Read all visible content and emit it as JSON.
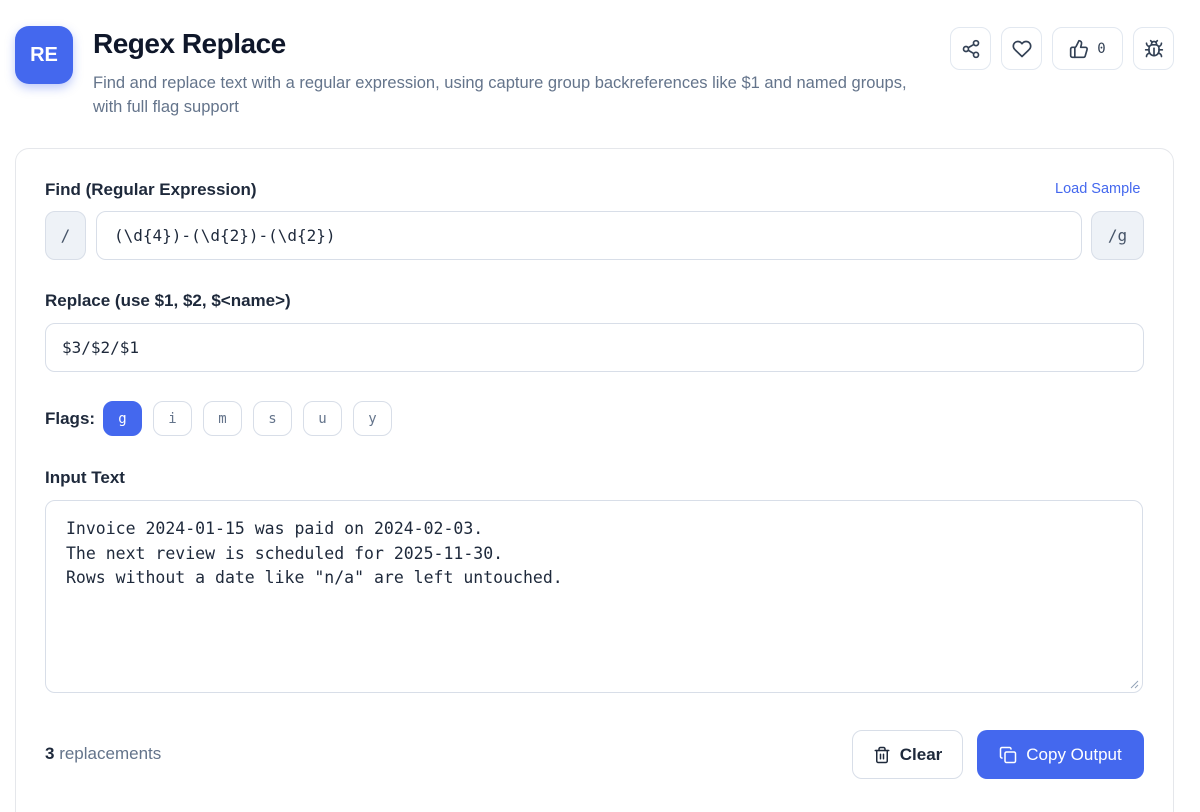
{
  "header": {
    "logo_text": "RE",
    "title": "Regex Replace",
    "subtitle": "Find and replace text with a regular expression, using capture group backreferences like $1 and named groups, with full flag support",
    "like_count": "0",
    "icons": [
      "share-icon",
      "heart-icon",
      "thumbs-up-icon",
      "bug-icon"
    ]
  },
  "find": {
    "label": "Find (Regular Expression)",
    "load_sample": "Load Sample",
    "prefix": "/",
    "value": "(\\d{4})-(\\d{2})-(\\d{2})",
    "suffix": "/g"
  },
  "replace": {
    "label": "Replace (use $1, $2, $<name>)",
    "value": "$3/$2/$1"
  },
  "flags": {
    "label": "Flags:",
    "items": [
      {
        "flag": "g",
        "active": true
      },
      {
        "flag": "i",
        "active": false
      },
      {
        "flag": "m",
        "active": false
      },
      {
        "flag": "s",
        "active": false
      },
      {
        "flag": "u",
        "active": false
      },
      {
        "flag": "y",
        "active": false
      }
    ]
  },
  "input": {
    "label": "Input Text",
    "value": "Invoice 2024-01-15 was paid on 2024-02-03.\nThe next review is scheduled for 2025-11-30.\nRows without a date like \"n/a\" are left untouched."
  },
  "footer": {
    "replacement_count": "3",
    "replacement_label": " replacements",
    "clear_label": "Clear",
    "copy_label": "Copy Output"
  },
  "colors": {
    "accent": "#4468ee"
  }
}
